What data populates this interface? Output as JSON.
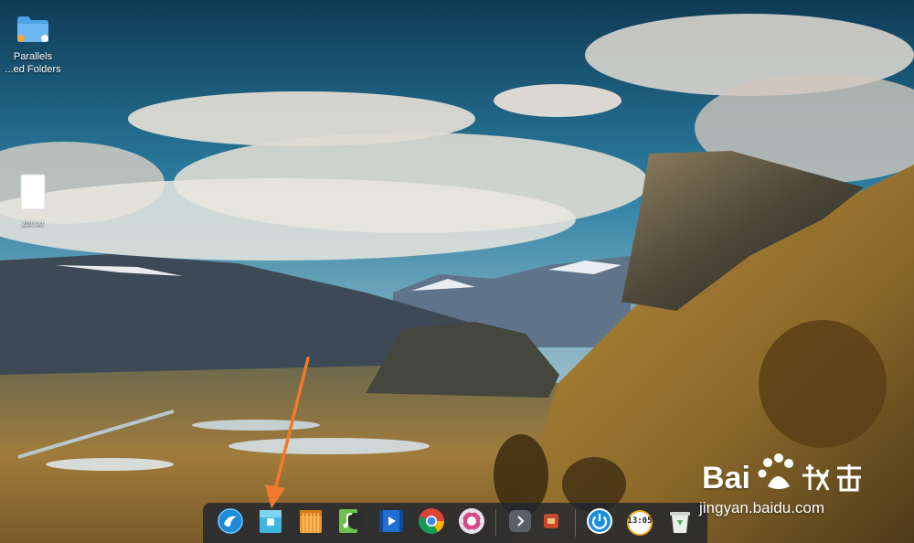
{
  "desktop": {
    "icons": [
      {
        "label": "Parallels\n...ed Folders",
        "icon": "shared-folder-icon"
      },
      {
        "label": "zbt.txt",
        "icon": "text-file-icon"
      }
    ]
  },
  "dock": {
    "items": [
      {
        "name": "launcher",
        "icon": "deepin-launcher-icon"
      },
      {
        "name": "file-manager",
        "icon": "file-manager-icon"
      },
      {
        "name": "app-store",
        "icon": "app-store-icon"
      },
      {
        "name": "music",
        "icon": "music-player-icon"
      },
      {
        "name": "movie",
        "icon": "movie-player-icon"
      },
      {
        "name": "chrome",
        "icon": "chrome-icon"
      },
      {
        "name": "settings",
        "icon": "settings-gear-icon"
      },
      {
        "name": "show-more",
        "icon": "chevron-right-icon"
      },
      {
        "name": "tray-app",
        "icon": "tray-app-icon"
      },
      {
        "name": "power",
        "icon": "power-icon"
      },
      {
        "name": "clock",
        "icon": "clock-icon",
        "time_text": "13:05"
      },
      {
        "name": "trash",
        "icon": "trash-icon"
      }
    ]
  },
  "overlay": {
    "arrow_color": "#f27a2e",
    "watermark_brand": "Bai",
    "watermark_text": "jingyan.baidu.com"
  }
}
